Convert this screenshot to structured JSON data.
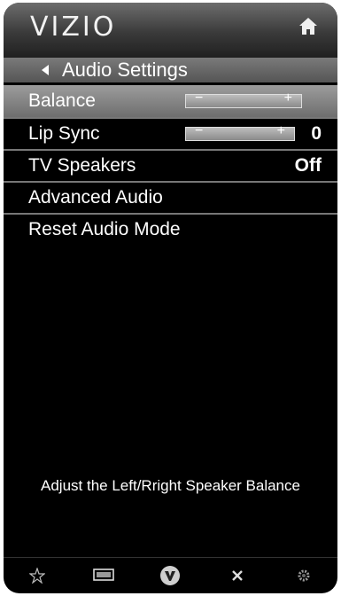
{
  "header": {
    "logo": "VIZIO"
  },
  "breadcrumb": {
    "label": "Audio Settings"
  },
  "menu": {
    "items": [
      {
        "label": "Balance",
        "value": ""
      },
      {
        "label": "Lip Sync",
        "value": "0"
      },
      {
        "label": "TV Speakers",
        "value": "Off"
      },
      {
        "label": "Advanced Audio",
        "value": ""
      },
      {
        "label": "Reset Audio Mode",
        "value": ""
      }
    ],
    "slider_minus": "−",
    "slider_plus": "+"
  },
  "description": "Adjust the Left/Rright Speaker Balance",
  "icons": {
    "home": "home-icon",
    "back": "back-arrow-icon",
    "nav": [
      "star-icon",
      "screen-icon",
      "vizio-v-icon",
      "close-icon",
      "gear-icon"
    ]
  }
}
